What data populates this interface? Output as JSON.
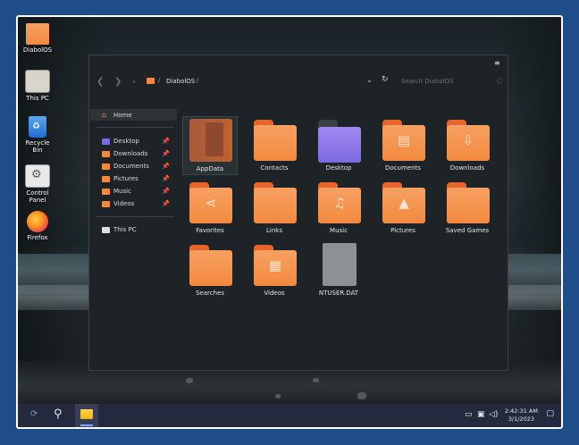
{
  "desktop": {
    "icons": [
      {
        "label": "DiabolOS",
        "icon": "folder-icon"
      },
      {
        "label": "This PC",
        "icon": "computer-icon"
      },
      {
        "label": "Recycle Bin",
        "icon": "recycle-bin-icon"
      },
      {
        "label": "Control Panel",
        "icon": "control-panel-icon"
      },
      {
        "label": "Firefox",
        "icon": "firefox-icon"
      }
    ]
  },
  "explorer": {
    "menu_glyph": "≡",
    "path": "DiabolOS",
    "search_placeholder": "Search DiabolOS",
    "sidebar": {
      "home": "Home",
      "quick_access": [
        {
          "label": "Desktop",
          "color": "#7b6be0"
        },
        {
          "label": "Downloads",
          "color": "#f58a3a"
        },
        {
          "label": "Documents",
          "color": "#f58a3a"
        },
        {
          "label": "Pictures",
          "color": "#f58a3a"
        },
        {
          "label": "Music",
          "color": "#f58a3a"
        },
        {
          "label": "Videos",
          "color": "#f58a3a"
        }
      ],
      "this_pc": "This PC"
    },
    "items": [
      {
        "label": "AppData",
        "icon": "appdata-folder-icon",
        "selected": true
      },
      {
        "label": "Contacts",
        "icon": "folder-icon"
      },
      {
        "label": "Desktop",
        "icon": "desktop-folder-icon"
      },
      {
        "label": "Documents",
        "icon": "documents-folder-icon"
      },
      {
        "label": "Downloads",
        "icon": "downloads-folder-icon"
      },
      {
        "label": "Favorites",
        "icon": "share-folder-icon"
      },
      {
        "label": "Links",
        "icon": "folder-icon"
      },
      {
        "label": "Music",
        "icon": "music-folder-icon"
      },
      {
        "label": "Pictures",
        "icon": "pictures-folder-icon"
      },
      {
        "label": "Saved Games",
        "icon": "folder-icon"
      },
      {
        "label": "Searches",
        "icon": "folder-icon"
      },
      {
        "label": "Videos",
        "icon": "videos-folder-icon"
      },
      {
        "label": "NTUSER.DAT",
        "icon": "file-icon"
      }
    ]
  },
  "taskbar": {
    "time": "2:42:31 AM",
    "date": "3/1/2023"
  },
  "colors": {
    "accent": "#f58a3a",
    "taskbar": "#24293d",
    "window_bg": "#1d2326"
  }
}
